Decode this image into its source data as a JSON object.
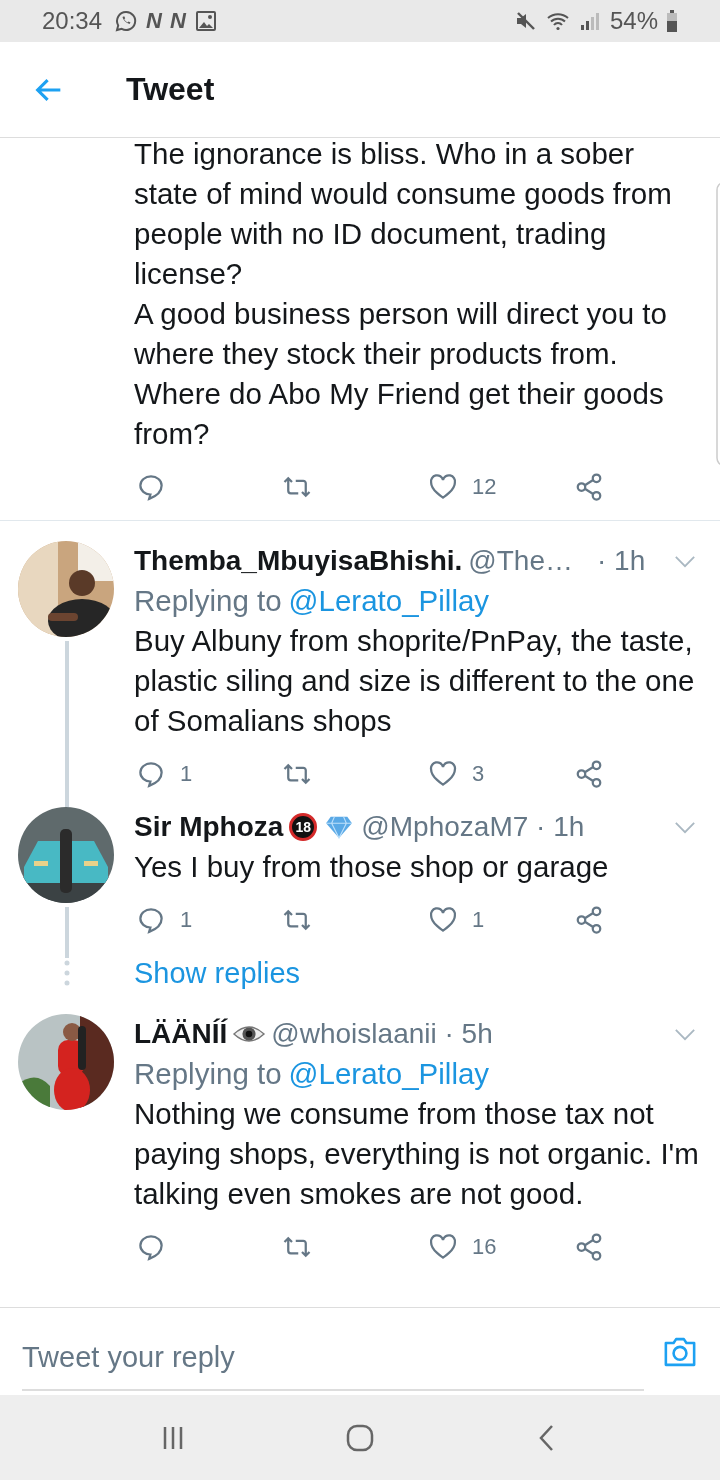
{
  "status_bar": {
    "time": "20:34",
    "notification_icons": [
      "N",
      "N"
    ],
    "battery": "54%"
  },
  "header": {
    "title": "Tweet"
  },
  "tweets": [
    {
      "kind": "continued",
      "text": "The ignorance is bliss. Who in a sober state of mind would consume goods from people with no ID document, trading license?\nA good business person will direct you to where they stock their products from. Where do Abo My Friend get their goods from?",
      "actions": {
        "likes": "12"
      },
      "thread_below": false
    },
    {
      "kind": "reply",
      "name": "Themba_MbuyisaBhishi.",
      "handle": "@The…",
      "time": "· 1h",
      "replying_label": "Replying to",
      "replying_to": "@Lerato_Pillay",
      "text": "Buy Albuny from shoprite/PnPay, the taste, plastic siling and size is different to the one of Somalians shops",
      "actions": {
        "replies": "1",
        "likes": "3"
      },
      "thread_below": true
    },
    {
      "kind": "reply",
      "name": "Sir Mphoza",
      "badges": [
        {
          "kind": "no18",
          "text": "18"
        },
        {
          "kind": "diamond"
        }
      ],
      "handle": "@MphozaM7 · 1h",
      "text": "Yes I buy from those shop or garage",
      "actions": {
        "replies": "1",
        "likes": "1"
      },
      "thread_below": true,
      "show_replies": "Show replies"
    },
    {
      "kind": "reply",
      "name": "LÄÄNÍÍ",
      "badges": [
        {
          "kind": "eye"
        }
      ],
      "handle": "@whoislaanii · 5h",
      "replying_label": "Replying to",
      "replying_to": "@Lerato_Pillay",
      "text": "Nothing we consume from those tax not paying shops, everything is not organic. I'm talking even smokes are not good.",
      "actions": {
        "likes": "16"
      },
      "thread_below": false
    }
  ],
  "reply_bar": {
    "placeholder": "Tweet your reply"
  }
}
